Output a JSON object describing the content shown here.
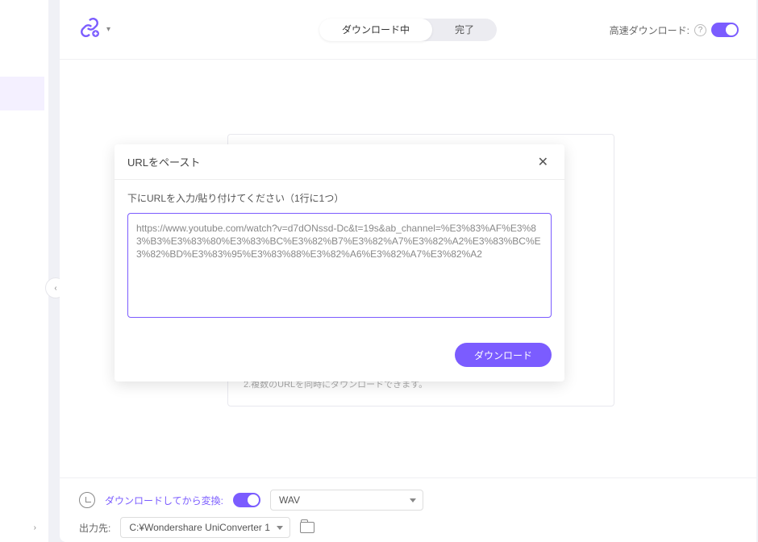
{
  "sidebar": {
    "collapse_glyph": "‹",
    "expand_glyph": "›"
  },
  "topbar": {
    "tabs": {
      "downloading": "ダウンロード中",
      "done": "完了"
    },
    "fast_download_label": "高速ダウンロード:"
  },
  "hint": "2.複数のURLを同時にダウンロードできます。",
  "modal": {
    "title": "URLをペースト",
    "instruction": "下にURLを入力/貼り付けてください（1行に1つ）",
    "url": "https://www.youtube.com/watch?v=d7dONssd-Dc&t=19s&ab_channel=%E3%83%AF%E3%83%B3%E3%83%80%E3%83%BC%E3%82%B7%E3%82%A7%E3%82%A2%E3%83%BC%E3%82%BD%E3%83%95%E3%83%88%E3%82%A6%E3%82%A7%E3%82%A2",
    "download_button": "ダウンロード"
  },
  "bottom": {
    "convert_label": "ダウンロードしてから変換:",
    "format": "WAV",
    "output_label": "出力先:",
    "output_path": "C:¥Wondershare UniConverter 1"
  }
}
